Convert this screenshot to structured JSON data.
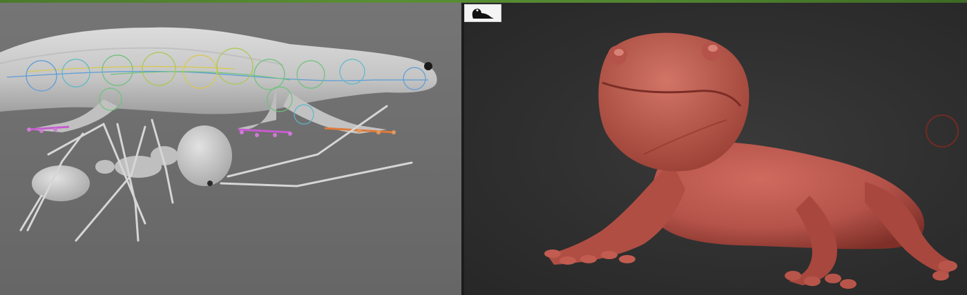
{
  "top_strip": {
    "color": "#4f8430"
  },
  "left_viewport": {
    "background": "#6f6f6f",
    "model_color": "#c9c9c9",
    "rig_colors": [
      "#5a9bd8",
      "#6cc27a",
      "#d8c94a",
      "#c85bd0",
      "#e07a3a"
    ]
  },
  "right_viewport": {
    "background": "#2f2f2f",
    "model_color": "#b5534a"
  },
  "thumbnail": {
    "icon": "salamander-silhouette-icon"
  },
  "brush": {
    "icon": "brush-cursor-circle"
  }
}
